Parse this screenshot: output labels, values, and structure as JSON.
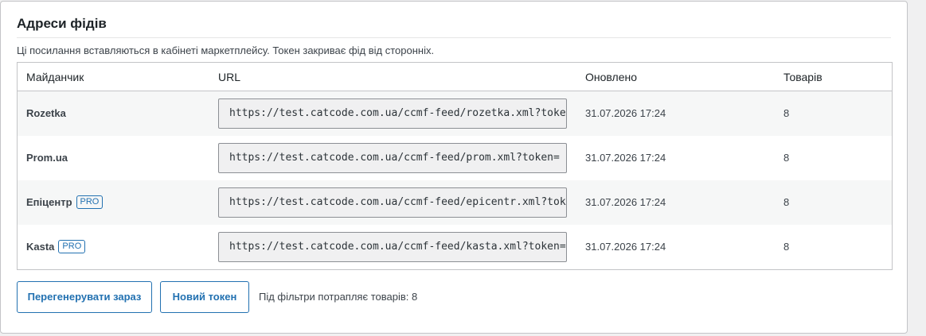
{
  "section": {
    "title": "Адреси фідів",
    "description": "Ці посилання вставляються в кабінеті маркетплейсу. Токен закриває фід від сторонніх."
  },
  "table": {
    "headers": {
      "marketplace": "Майданчик",
      "url": "URL",
      "updated": "Оновлено",
      "products": "Товарів"
    },
    "rows": [
      {
        "name": "Rozetka",
        "badge": "",
        "url": "https://test.catcode.com.ua/ccmf-feed/rozetka.xml?token=",
        "updated": "31.07.2026 17:24",
        "count": "8"
      },
      {
        "name": "Prom.ua",
        "badge": "",
        "url": "https://test.catcode.com.ua/ccmf-feed/prom.xml?token=",
        "updated": "31.07.2026 17:24",
        "count": "8"
      },
      {
        "name": "Епіцентр",
        "badge": "PRO",
        "url": "https://test.catcode.com.ua/ccmf-feed/epicentr.xml?token=",
        "updated": "31.07.2026 17:24",
        "count": "8"
      },
      {
        "name": "Kasta",
        "badge": "PRO",
        "url": "https://test.catcode.com.ua/ccmf-feed/kasta.xml?token=",
        "updated": "31.07.2026 17:24",
        "count": "8"
      }
    ]
  },
  "actions": {
    "regenerate_label": "Перегенерувати зараз",
    "new_token_label": "Новий токен",
    "filter_status": "Під фільтри потрапляє товарів: 8"
  },
  "colors": {
    "accent": "#2271b1",
    "row_alt": "#f6f7f7",
    "border": "#c3c4c7"
  }
}
